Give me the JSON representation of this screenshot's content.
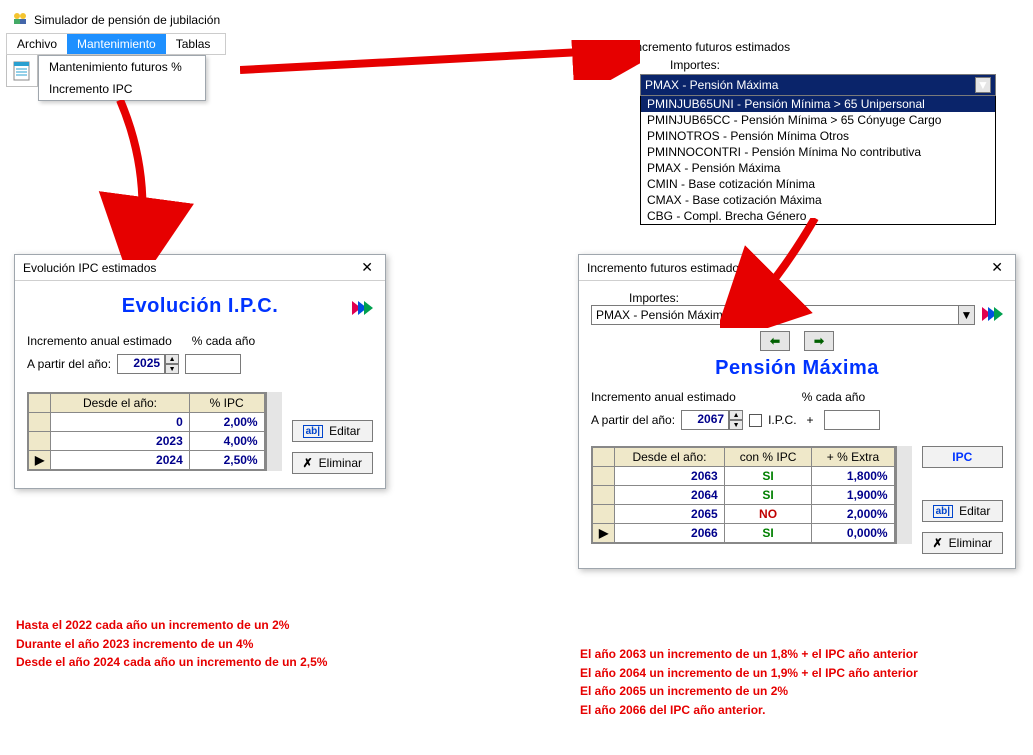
{
  "app": {
    "title": "Simulador de pensión de jubilación"
  },
  "menu": {
    "items": [
      "Archivo",
      "Mantenimiento",
      "Tablas"
    ],
    "active_index": 1,
    "submenu": [
      "Mantenimiento futuros %",
      "Incremento IPC"
    ]
  },
  "top_right": {
    "heading": "Incremento futuros estimados",
    "importes_label": "Importes:",
    "selected": "PMAX - Pensión Máxima",
    "options": [
      "PMINJUB65UNI - Pensión Mínima > 65 Unipersonal",
      "PMINJUB65CC - Pensión Mínima > 65 Cónyuge Cargo",
      "PMINOTROS - Pensión Mínima Otros",
      "PMINNOCONTRI - Pensión Mínima No contributiva",
      "PMAX - Pensión Máxima",
      "CMIN - Base cotización Mínima",
      "CMAX - Base cotización Máxima",
      "CBG - Compl. Brecha Género"
    ],
    "highlight_index": 0
  },
  "ipc_dialog": {
    "window_title": "Evolución IPC estimados",
    "big_title": "Evolución I.P.C.",
    "label_incr": "Incremento anual estimado",
    "label_pct": "% cada año",
    "label_from": "A partir del año:",
    "year": "2025",
    "extra": "",
    "columns": [
      "Desde el año:",
      "% IPC"
    ],
    "rows": [
      {
        "year": "0",
        "pct": "2,00%",
        "selected": false
      },
      {
        "year": "2023",
        "pct": "4,00%",
        "selected": false
      },
      {
        "year": "2024",
        "pct": "2,50%",
        "selected": true
      }
    ],
    "btn_edit": "Editar",
    "btn_delete": "Eliminar"
  },
  "fut_dialog": {
    "window_title": "Incremento futuros estimado",
    "importes_label": "Importes:",
    "combo_value": "PMAX - Pensión Máxima",
    "big_title": "Pensión Máxima",
    "label_incr": "Incremento anual estimado",
    "label_pct": "% cada año",
    "label_from": "A partir del año:",
    "year": "2067",
    "ipc_check_label": "I.P.C.",
    "plus": "+",
    "extra": "",
    "columns": [
      "Desde el año:",
      "con % IPC",
      "+  % Extra"
    ],
    "rows": [
      {
        "year": "2063",
        "ipc": "SI",
        "extra": "1,800%",
        "selected": false
      },
      {
        "year": "2064",
        "ipc": "SI",
        "extra": "1,900%",
        "selected": false
      },
      {
        "year": "2065",
        "ipc": "NO",
        "extra": "2,000%",
        "selected": false
      },
      {
        "year": "2066",
        "ipc": "SI",
        "extra": "0,000%",
        "selected": true
      }
    ],
    "btn_ipc": "IPC",
    "btn_edit": "Editar",
    "btn_delete": "Eliminar"
  },
  "anno_left": [
    "Hasta el 2022 cada año un incremento de un 2%",
    "Durante el año 2023 incremento de un 4%",
    "Desde el año 2024 cada año un incremento de un 2,5%"
  ],
  "anno_right": [
    "El año 2063 un incremento de un 1,8%  + el IPC año anterior",
    "El año 2064 un incremento de un 1,9%  + el IPC año anterior",
    "El año 2065 un incremento de un 2%",
    "El año 2066 del IPC año anterior."
  ]
}
